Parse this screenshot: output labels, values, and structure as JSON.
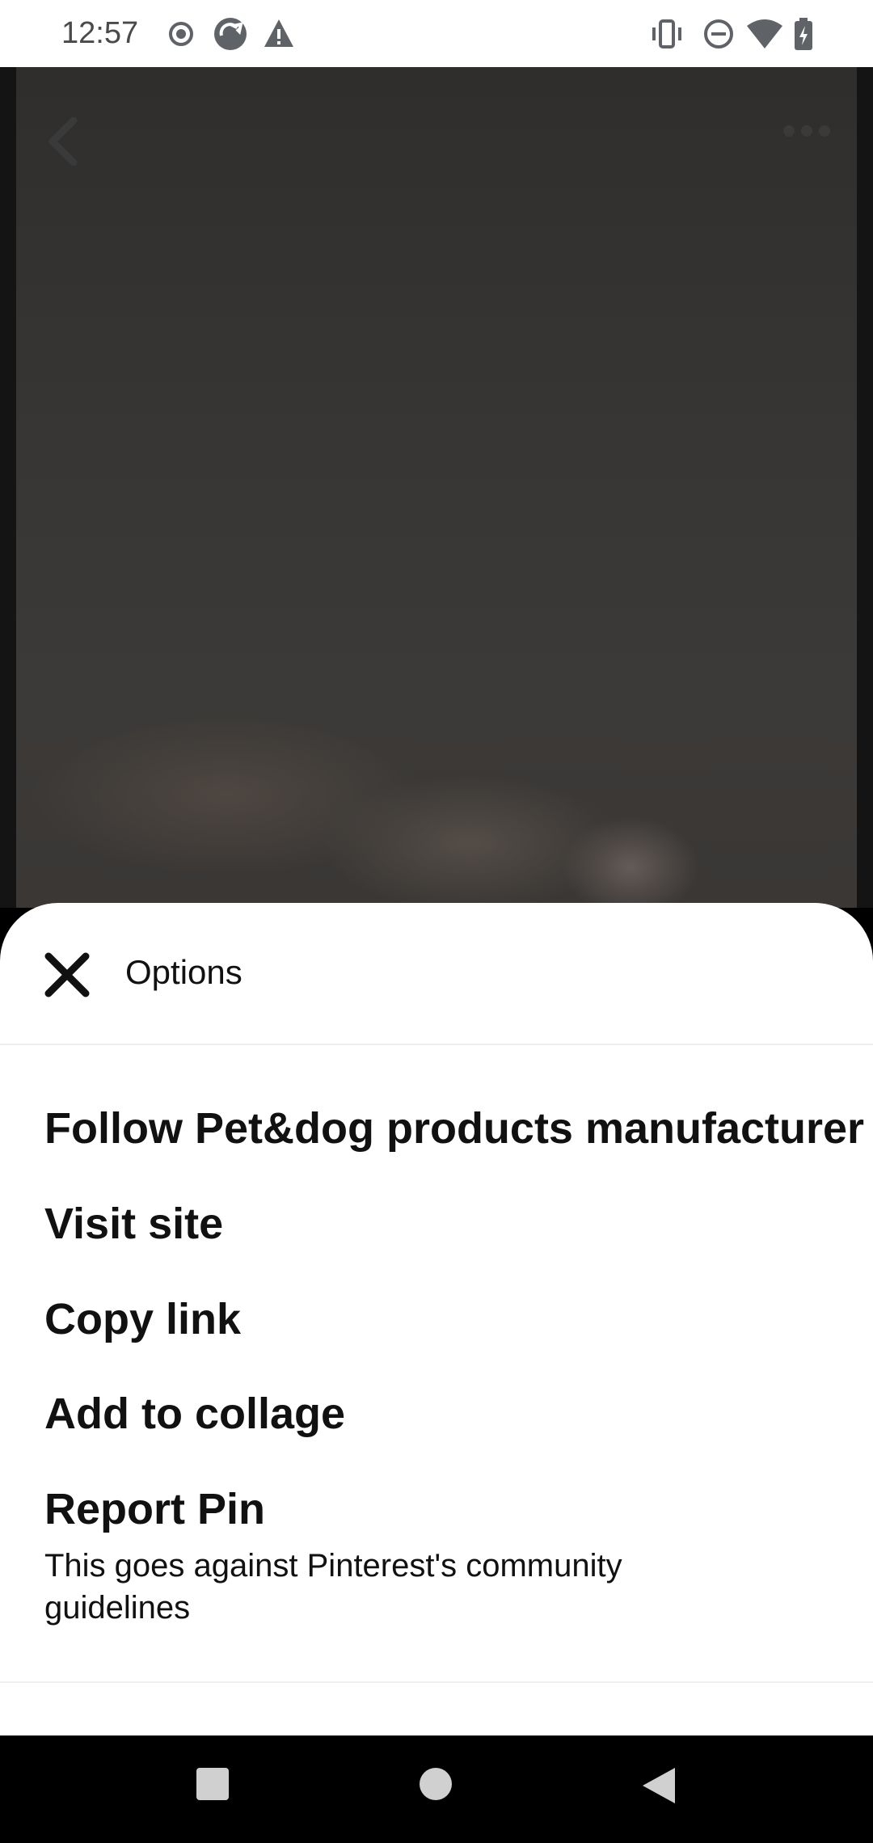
{
  "status_bar": {
    "time": "12:57",
    "left_icons": [
      "record-icon",
      "sync-icon",
      "warning-icon"
    ],
    "right_icons": [
      "vibrate-icon",
      "do-not-disturb-icon",
      "wifi-icon",
      "battery-charging-icon"
    ]
  },
  "pin": {
    "back_icon": "chevron-left-icon",
    "more_icon": "more-horizontal-icon"
  },
  "sheet": {
    "title": "Options",
    "close_icon": "close-icon",
    "items": [
      {
        "label": "Follow Pet&dog products manufacturer"
      },
      {
        "label": "Visit site"
      },
      {
        "label": "Copy link"
      },
      {
        "label": "Add to collage"
      },
      {
        "label": "Report Pin",
        "subtitle": "This goes against Pinterest's community guidelines"
      }
    ]
  },
  "nav_bar": {
    "icons": [
      "recents-square-icon",
      "home-circle-icon",
      "back-triangle-icon"
    ]
  },
  "colors": {
    "sheet_bg": "#ffffff",
    "text": "#111111",
    "scrim": "#141414"
  }
}
